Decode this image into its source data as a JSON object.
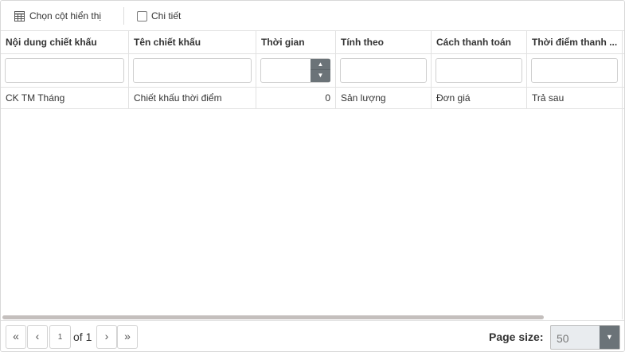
{
  "toolbar": {
    "columns_label": "Chọn cột hiển thị",
    "details_label": "Chi tiết",
    "columns_icon": "table-columns-icon",
    "details_icon": "checkbox-icon"
  },
  "columns": [
    "Nội dung chiết khấu",
    "Tên chiết khấu",
    "Thời gian",
    "Tính theo",
    "Cách thanh toán",
    "Thời điểm thanh ..."
  ],
  "filters": {
    "col1": "",
    "col2": "",
    "col3": "",
    "col4": "",
    "col5": "",
    "col6": ""
  },
  "rows": [
    {
      "noi_dung": "CK TM Tháng",
      "ten": "Chiết khấu thời điểm",
      "thoi_gian": "0",
      "tinh_theo": "Sản lượng",
      "cach_thanh_toan": "Đơn giá",
      "thoi_diem": "Trả sau"
    }
  ],
  "pager": {
    "first_icon": "«",
    "prev_icon": "‹",
    "next_icon": "›",
    "last_icon": "»",
    "page": "1",
    "of_label": "of 1",
    "page_size_label": "Page size:",
    "page_size": "50"
  },
  "colors": {
    "accent_dark": "#6b7378",
    "border": "#e2e2e2",
    "scrollbar": "#c4bfbd"
  }
}
